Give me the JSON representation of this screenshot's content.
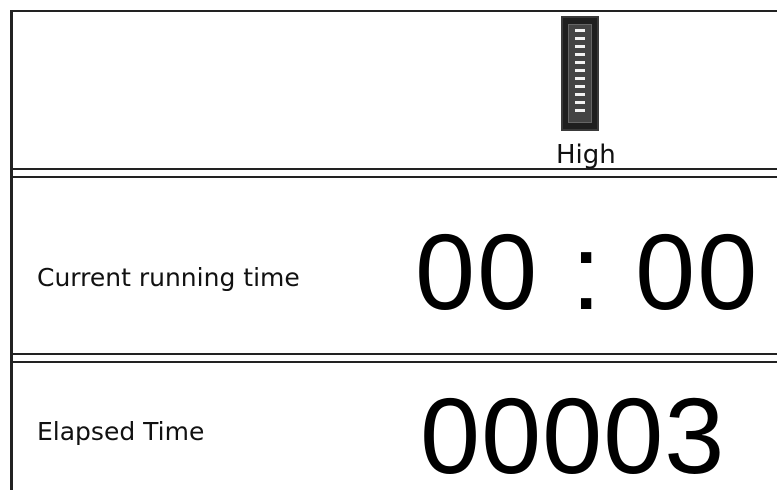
{
  "level": {
    "label": "High",
    "icon": "level-bar-icon",
    "segments": 11
  },
  "current_running_time": {
    "label": "Current running time",
    "value": "00 : 00"
  },
  "elapsed_time": {
    "label": "Elapsed Time",
    "value": "00003"
  }
}
